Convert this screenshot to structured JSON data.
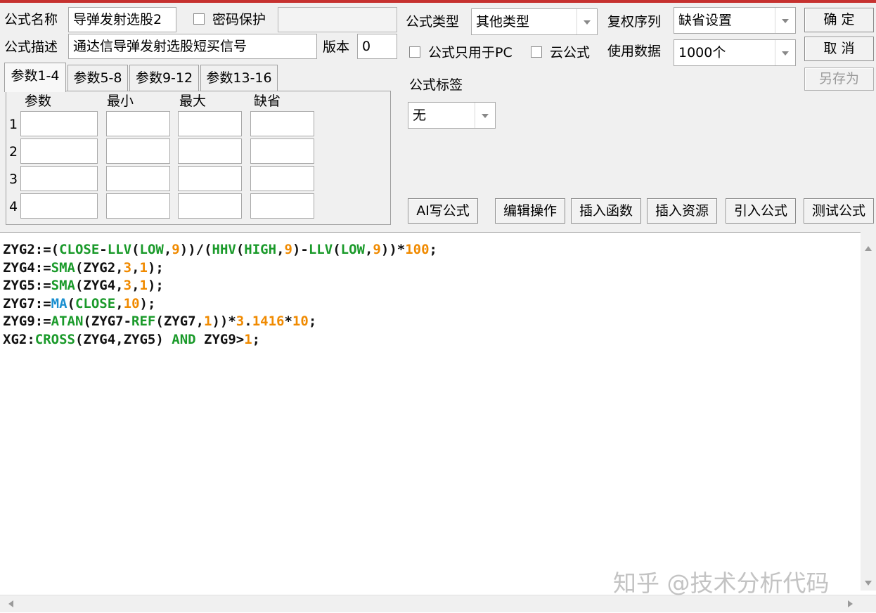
{
  "form": {
    "name_label": "公式名称",
    "name_value": "导弹发射选股2",
    "password_label": "密码保护",
    "password_value": "",
    "desc_label": "公式描述",
    "desc_value": "通达信导弹发射选股短买信号",
    "version_label": "版本",
    "version_value": "0",
    "type_label": "公式类型",
    "type_value": "其他类型",
    "fq_label": "复权序列",
    "fq_value": "缺省设置",
    "pc_only_label": "公式只用于PC",
    "cloud_label": "云公式",
    "data_label": "使用数据",
    "data_value": "1000个",
    "tag_label": "公式标签",
    "tag_value": "无"
  },
  "buttons": {
    "ok": "确  定",
    "cancel": "取  消",
    "save_as": "另存为",
    "ai": "AI写公式",
    "edit": "编辑操作",
    "insert_func": "插入函数",
    "insert_res": "插入资源",
    "import": "引入公式",
    "test": "测试公式"
  },
  "tabs": [
    "参数1-4",
    "参数5-8",
    "参数9-12",
    "参数13-16"
  ],
  "params": {
    "headers": [
      "参数",
      "最小",
      "最大",
      "缺省"
    ],
    "rows": [
      "1",
      "2",
      "3",
      "4"
    ]
  },
  "code_lines": [
    [
      [
        "ZYG2:=(",
        "#111111"
      ],
      [
        "CLOSE",
        "#1a9a2a"
      ],
      [
        "-",
        "#111111"
      ],
      [
        "LLV",
        "#1a9a2a"
      ],
      [
        "(",
        "#111111"
      ],
      [
        "LOW",
        "#1a9a2a"
      ],
      [
        ",",
        "#111111"
      ],
      [
        "9",
        "#f08a00"
      ],
      [
        "))/(",
        "#111111"
      ],
      [
        "HHV",
        "#1a9a2a"
      ],
      [
        "(",
        "#111111"
      ],
      [
        "HIGH",
        "#1a9a2a"
      ],
      [
        ",",
        "#111111"
      ],
      [
        "9",
        "#f08a00"
      ],
      [
        ")-",
        "#111111"
      ],
      [
        "LLV",
        "#1a9a2a"
      ],
      [
        "(",
        "#111111"
      ],
      [
        "LOW",
        "#1a9a2a"
      ],
      [
        ",",
        "#111111"
      ],
      [
        "9",
        "#f08a00"
      ],
      [
        "))*",
        "#111111"
      ],
      [
        "100",
        "#f08a00"
      ],
      [
        ";",
        "#111111"
      ]
    ],
    [
      [
        "ZYG4:=",
        "#111111"
      ],
      [
        "SMA",
        "#1a9a2a"
      ],
      [
        "(ZYG2,",
        "#111111"
      ],
      [
        "3",
        "#f08a00"
      ],
      [
        ",",
        "#111111"
      ],
      [
        "1",
        "#f08a00"
      ],
      [
        ");",
        "#111111"
      ]
    ],
    [
      [
        "ZYG5:=",
        "#111111"
      ],
      [
        "SMA",
        "#1a9a2a"
      ],
      [
        "(ZYG4,",
        "#111111"
      ],
      [
        "3",
        "#f08a00"
      ],
      [
        ",",
        "#111111"
      ],
      [
        "1",
        "#f08a00"
      ],
      [
        ");",
        "#111111"
      ]
    ],
    [
      [
        "ZYG7:=",
        "#111111"
      ],
      [
        "MA",
        "#1a8fd0"
      ],
      [
        "(",
        "#111111"
      ],
      [
        "CLOSE",
        "#1a9a2a"
      ],
      [
        ",",
        "#111111"
      ],
      [
        "10",
        "#f08a00"
      ],
      [
        ");",
        "#111111"
      ]
    ],
    [
      [
        "ZYG9:=",
        "#111111"
      ],
      [
        "ATAN",
        "#1a9a2a"
      ],
      [
        "(ZYG7-",
        "#111111"
      ],
      [
        "REF",
        "#1a9a2a"
      ],
      [
        "(ZYG7,",
        "#111111"
      ],
      [
        "1",
        "#f08a00"
      ],
      [
        "))*",
        "#111111"
      ],
      [
        "3",
        "#f08a00"
      ],
      [
        ".",
        "#111111"
      ],
      [
        "1416",
        "#f08a00"
      ],
      [
        "*",
        "#111111"
      ],
      [
        "10",
        "#f08a00"
      ],
      [
        ";",
        "#111111"
      ]
    ],
    [
      [
        "XG2:",
        "#111111"
      ],
      [
        "CROSS",
        "#1a9a2a"
      ],
      [
        "(ZYG4,ZYG5) ",
        "#111111"
      ],
      [
        "AND",
        "#1a9a2a"
      ],
      [
        " ZYG9>",
        "#111111"
      ],
      [
        "1",
        "#f08a00"
      ],
      [
        ";",
        "#111111"
      ]
    ]
  ],
  "watermark": "知乎 @技术分析代码"
}
